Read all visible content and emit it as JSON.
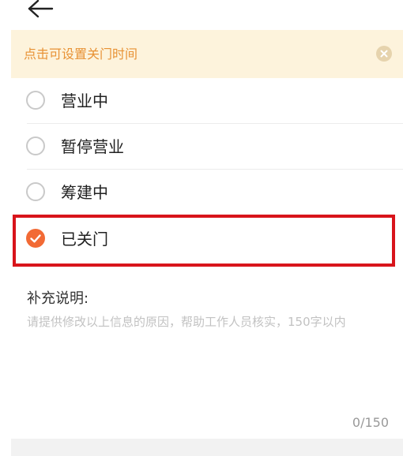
{
  "header": {
    "back_icon": "arrow-left-icon"
  },
  "tip": {
    "text": "点击可设置关门时间",
    "close_icon": "close-circle-icon",
    "bg_color": "#fdf3dc",
    "text_color": "#e89235"
  },
  "options": [
    {
      "label": "营业中",
      "selected": false
    },
    {
      "label": "暂停营业",
      "selected": false
    },
    {
      "label": "筹建中",
      "selected": false
    },
    {
      "label": "已关门",
      "selected": true
    }
  ],
  "accent_color": "#f26a35",
  "highlight_color": "#d8141b",
  "note": {
    "title": "补充说明:",
    "placeholder": "请提供修改以上信息的原因，帮助工作人员核实，150字以内",
    "value": "",
    "counter": "0/150"
  }
}
